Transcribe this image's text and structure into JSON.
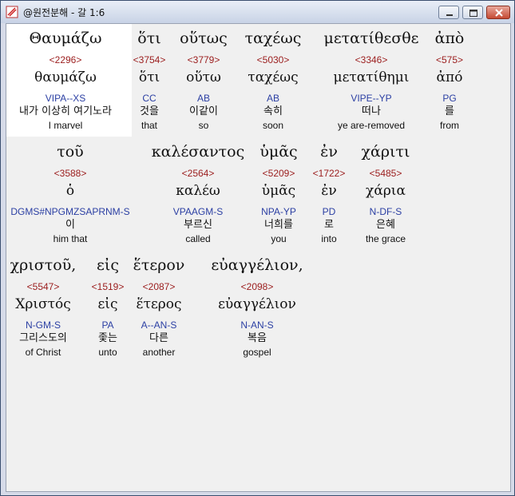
{
  "window": {
    "title": "@원전분해 - 갈 1:6"
  },
  "verse": [
    {
      "greek": "Θαυμάζω",
      "strong": "<2296>",
      "lemma": "θαυμάζω",
      "morph": "VIPA--XS",
      "korean": "내가 이상히 여기노라",
      "english": "I marvel"
    },
    {
      "greek": "ὅτι",
      "strong": "<3754>",
      "lemma": "ὅτι",
      "morph": "CC",
      "korean": "것을",
      "english": "that"
    },
    {
      "greek": "οὕτως",
      "strong": "<3779>",
      "lemma": "οὕτω",
      "morph": "AB",
      "korean": "이같이",
      "english": "so"
    },
    {
      "greek": "ταχέως",
      "strong": "<5030>",
      "lemma": "ταχέως",
      "morph": "AB",
      "korean": "속히",
      "english": "soon"
    },
    {
      "greek": "μετατίθεσθε",
      "strong": "<3346>",
      "lemma": "μετατίθημι",
      "morph": "VIPE--YP",
      "korean": "떠나",
      "english": "ye are-removed"
    },
    {
      "greek": "ἀπὸ",
      "strong": "<575>",
      "lemma": "ἀπό",
      "morph": "PG",
      "korean": "를",
      "english": "from"
    },
    {
      "greek": "τοῦ",
      "strong": "<3588>",
      "lemma": "ὁ",
      "morph": "DGMS#NPGMZSAPRNM-S",
      "korean": "이",
      "english": "him that"
    },
    {
      "greek": "καλέσαντος",
      "strong": "<2564>",
      "lemma": "καλέω",
      "morph": "VPAAGM-S",
      "korean": "부르신",
      "english": "called"
    },
    {
      "greek": "ὑμᾶς",
      "strong": "<5209>",
      "lemma": "ὑμᾶς",
      "morph": "NPA-YP",
      "korean": "너희를",
      "english": "you"
    },
    {
      "greek": "ἐν",
      "strong": "<1722>",
      "lemma": "ἐν",
      "morph": "PD",
      "korean": "로",
      "english": "into"
    },
    {
      "greek": "χάριτι",
      "strong": "<5485>",
      "lemma": "χάρια",
      "morph": "N-DF-S",
      "korean": "은혜",
      "english": "the grace"
    },
    {
      "greek": "χριστοῦ,",
      "strong": "<5547>",
      "lemma": "Χριστός",
      "morph": "N-GM-S",
      "korean": "그리스도의",
      "english": "of Christ"
    },
    {
      "greek": "εἰς",
      "strong": "<1519>",
      "lemma": "εἰς",
      "morph": "PA",
      "korean": "좇는",
      "english": "unto"
    },
    {
      "greek": "ἕτερον",
      "strong": "<2087>",
      "lemma": "ἕτερος",
      "morph": "A--AN-S",
      "korean": "다른",
      "english": "another"
    },
    {
      "greek": "εὐαγγέλιον,",
      "strong": "<2098>",
      "lemma": "εὐαγγέλιον",
      "morph": "N-AN-S",
      "korean": "복음",
      "english": "gospel"
    }
  ]
}
